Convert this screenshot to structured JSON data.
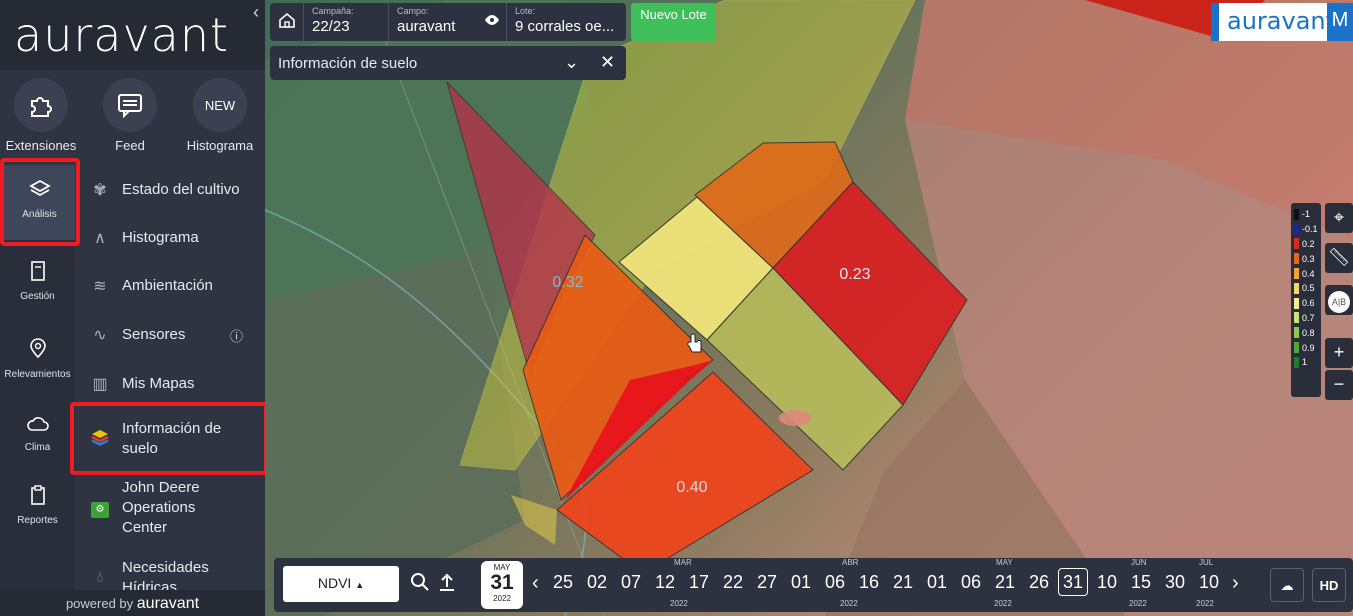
{
  "sidebar": {
    "brand": "auravant",
    "quick_actions": [
      {
        "label": "Extensiones",
        "icon": "puzzle-icon"
      },
      {
        "label": "Feed",
        "icon": "chat-icon"
      },
      {
        "label": "Histograma",
        "badge": "NEW"
      }
    ],
    "rail": [
      {
        "label": "Análisis",
        "icon": "layers-icon"
      },
      {
        "label": "Gestión",
        "icon": "document-icon"
      },
      {
        "label": "Relevamientos",
        "icon": "pin-icon"
      },
      {
        "label": "Clima",
        "icon": "cloud-icon"
      },
      {
        "label": "Reportes",
        "icon": "clipboard-icon"
      }
    ],
    "menu": [
      {
        "label": "Estado del cultivo",
        "icon": "plant-icon"
      },
      {
        "label": "Histograma",
        "icon": "curve-icon"
      },
      {
        "label": "Ambientación",
        "icon": "stack-icon"
      },
      {
        "label": "Sensores",
        "icon": "pulse-icon"
      },
      {
        "label": "Mis Mapas",
        "icon": "map-icon"
      },
      {
        "label": "Información de suelo",
        "icon": "soil-layers-icon"
      },
      {
        "label": "John Deere Operations Center",
        "icon": "tractor-icon"
      },
      {
        "label": "Necesidades Hídricas",
        "icon": "drop-icon"
      }
    ],
    "footer_prefix": "powered by",
    "footer_brand": "auravant"
  },
  "topbar": {
    "campana_label": "Campaña:",
    "campana_value": "22/23",
    "campo_label": "Campo:",
    "campo_value": "auravant",
    "lote_label": "Lote:",
    "lote_value": "9 corrales oe...",
    "nuevo_lote": "Nuevo Lote"
  },
  "soil_panel": {
    "title": "Información de suelo"
  },
  "brand_box": {
    "logo": "auravant",
    "letter": "M"
  },
  "map": {
    "field_values": [
      "0.32",
      "0.23",
      "0.40"
    ],
    "legend": [
      "-1",
      "-0.1",
      "0.2",
      "0.3",
      "0.4",
      "0.5",
      "0.6",
      "0.7",
      "0.8",
      "0.9",
      "1"
    ],
    "legend_colors": [
      "#111111",
      "#1a2a8a",
      "#d92b1c",
      "#e8641a",
      "#f2a338",
      "#f5d26a",
      "#f0ec9a",
      "#c6e07a",
      "#8fc653",
      "#4fa63a",
      "#1e7b2c"
    ]
  },
  "timeline": {
    "index": "NDVI",
    "selected": {
      "month": "MAY",
      "day": "31",
      "year": "2022"
    },
    "month_labels": [
      "MAR",
      "ABR",
      "MAY",
      "JUN",
      "JUL"
    ],
    "days": [
      "25",
      "02",
      "07",
      "12",
      "17",
      "22",
      "27",
      "01",
      "06",
      "16",
      "21",
      "01",
      "06",
      "21",
      "26",
      "31",
      "10",
      "15",
      "30",
      "10"
    ],
    "selected_day_index": 15,
    "year_label": "2022",
    "hd": "HD"
  }
}
